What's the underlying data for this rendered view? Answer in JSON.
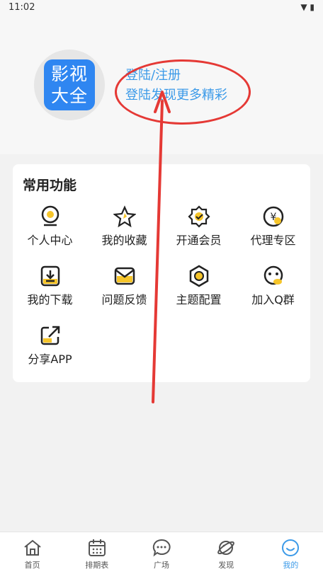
{
  "status_bar": {
    "time": "11:02",
    "icons": "▼ ▮"
  },
  "profile": {
    "logo_line1": "影视",
    "logo_line2": "大全",
    "login_label": "登陆/注册",
    "login_hint": "登陆发现更多精彩"
  },
  "functions": {
    "title": "常用功能",
    "items": [
      {
        "label": "个人中心",
        "icon": "user-center-icon"
      },
      {
        "label": "我的收藏",
        "icon": "star-icon"
      },
      {
        "label": "开通会员",
        "icon": "vip-badge-icon"
      },
      {
        "label": "代理专区",
        "icon": "yuan-coin-icon"
      },
      {
        "label": "我的下载",
        "icon": "download-icon"
      },
      {
        "label": "问题反馈",
        "icon": "feedback-mail-icon"
      },
      {
        "label": "主题配置",
        "icon": "theme-hex-icon"
      },
      {
        "label": "加入Q群",
        "icon": "qq-icon"
      },
      {
        "label": "分享APP",
        "icon": "share-icon"
      }
    ]
  },
  "tabbar": {
    "home": "首页",
    "schedule": "排期表",
    "square": "广场",
    "discover": "发现",
    "mine": "我的"
  },
  "colors": {
    "accent": "#3b9ae8",
    "icon_yellow": "#f6c52a",
    "annotation_red": "#e53935",
    "logo_blue": "#2f86f1"
  }
}
